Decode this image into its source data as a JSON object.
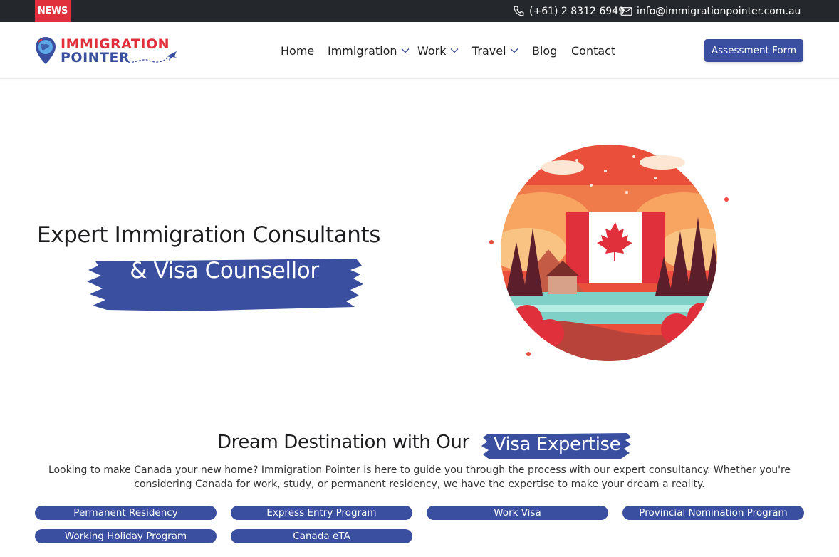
{
  "topbar": {
    "news_label": "NEWS",
    "phone": "(+61) 2 8312 6949",
    "email": "info@immigrationpointer.com.au",
    "phone_icon": "phone-icon",
    "email_icon": "mail-icon"
  },
  "brand": {
    "line1": "IMMIGRATION",
    "line2": "POINTER",
    "colors": {
      "red": "#e0303c",
      "blue": "#3a4fa0"
    }
  },
  "nav": {
    "items": [
      {
        "label": "Home",
        "dropdown": false
      },
      {
        "label": "Immigration",
        "dropdown": true
      },
      {
        "label": "Work",
        "dropdown": true
      },
      {
        "label": "Travel",
        "dropdown": true
      },
      {
        "label": "Blog",
        "dropdown": false
      },
      {
        "label": "Contact",
        "dropdown": false
      }
    ],
    "cta": "Assessment Form"
  },
  "hero": {
    "title": "Expert Immigration Consultants",
    "highlight": "& Visa Counsellor"
  },
  "section": {
    "title": "Dream Destination with Our",
    "highlight": "Visa Expertise",
    "description": "Looking to make Canada your new home? Immigration Pointer is here to guide you through the process with our expert consultancy. Whether you're considering Canada for work, study, or permanent residency, we have the expertise to make your dream a reality."
  },
  "programs": [
    "Permanent Residency",
    "Express Entry Program",
    "Work Visa",
    "Provincial Nomination Program",
    "Working Holiday Program",
    "Canada eTA"
  ]
}
